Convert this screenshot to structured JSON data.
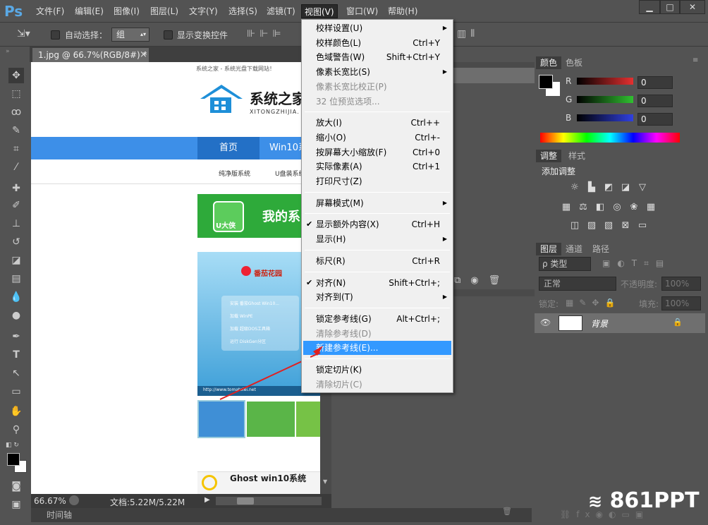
{
  "app": {
    "logo": "Ps"
  },
  "menubar": {
    "items": [
      "文件(F)",
      "编辑(E)",
      "图像(I)",
      "图层(L)",
      "文字(Y)",
      "选择(S)",
      "滤镜(T)",
      "视图(V)",
      "窗口(W)",
      "帮助(H)"
    ],
    "window_controls": [
      "▁",
      "□",
      "✕"
    ]
  },
  "options": {
    "auto_select_label": "自动选择：",
    "auto_select_value": "组",
    "show_transform_label": "显示变换控件"
  },
  "document": {
    "tab_title": "1.jpg @ 66.7%(RGB/8#) *",
    "tab_close": "×",
    "zoom": "66.67%",
    "doc_info": "文档:5.22M/5.22M",
    "timeline_label": "时间轴"
  },
  "webpage": {
    "top_text": "系统之家 - 系统光盘下载网站！",
    "logo_cn": "系统之家",
    "logo_pinyin": "XITONGZHIJIA.",
    "nav_home": "首页",
    "nav_win10": "Win10系",
    "subnav1": "纯净版系统",
    "subnav2": "U盘装系统",
    "banner_brand": "U大侠",
    "banner_text": "我的系",
    "promo_brand": "番茄花园",
    "promo_items": [
      "安装 番茄Ghost Win10...",
      "加载 WinPE",
      "加载 超级DOS工具箱",
      "运行 DiskGen分区"
    ],
    "promo_url": "http://www.tomatolei.net",
    "bottom_title": "Ghost win10系统"
  },
  "color_panel": {
    "tabs": [
      "颜色",
      "色板"
    ],
    "channels": [
      {
        "name": "R",
        "value": "0",
        "color": "#e53030"
      },
      {
        "name": "G",
        "value": "0",
        "color": "#30c030"
      },
      {
        "name": "B",
        "value": "0",
        "color": "#3040e0"
      }
    ]
  },
  "adjust_panel": {
    "tabs": [
      "调整",
      "样式"
    ],
    "title": "添加调整"
  },
  "layers_panel": {
    "tabs": [
      "图层",
      "通道",
      "路径"
    ],
    "filter_label": "ρ 类型",
    "blend_mode": "正常",
    "opacity_label": "不透明度:",
    "opacity_value": "100%",
    "lock_label": "锁定:",
    "fill_label": "填充:",
    "fill_value": "100%",
    "layer_name": "背景"
  },
  "view_menu": {
    "items": [
      {
        "label": "校样设置(U)",
        "shortcut": "",
        "arrow": true,
        "disabled": false,
        "checked": false
      },
      {
        "label": "校样颜色(L)",
        "shortcut": "Ctrl+Y",
        "arrow": false,
        "disabled": false,
        "checked": false
      },
      {
        "label": "色域警告(W)",
        "shortcut": "Shift+Ctrl+Y",
        "arrow": false,
        "disabled": false,
        "checked": false
      },
      {
        "label": "像素长宽比(S)",
        "shortcut": "",
        "arrow": true,
        "disabled": false,
        "checked": false
      },
      {
        "label": "像素长宽比校正(P)",
        "shortcut": "",
        "arrow": false,
        "disabled": true,
        "checked": false
      },
      {
        "label": "32 位预览选项...",
        "shortcut": "",
        "arrow": false,
        "disabled": true,
        "checked": false
      },
      {
        "label": "放大(I)",
        "shortcut": "Ctrl++",
        "arrow": false,
        "disabled": false,
        "checked": false
      },
      {
        "label": "缩小(O)",
        "shortcut": "Ctrl+-",
        "arrow": false,
        "disabled": false,
        "checked": false
      },
      {
        "label": "按屏幕大小缩放(F)",
        "shortcut": "Ctrl+0",
        "arrow": false,
        "disabled": false,
        "checked": false
      },
      {
        "label": "实际像素(A)",
        "shortcut": "Ctrl+1",
        "arrow": false,
        "disabled": false,
        "checked": false
      },
      {
        "label": "打印尺寸(Z)",
        "shortcut": "",
        "arrow": false,
        "disabled": false,
        "checked": false
      },
      {
        "label": "屏幕模式(M)",
        "shortcut": "",
        "arrow": true,
        "disabled": false,
        "checked": false
      },
      {
        "label": "显示额外内容(X)",
        "shortcut": "Ctrl+H",
        "arrow": false,
        "disabled": false,
        "checked": true
      },
      {
        "label": "显示(H)",
        "shortcut": "",
        "arrow": true,
        "disabled": false,
        "checked": false
      },
      {
        "label": "标尺(R)",
        "shortcut": "Ctrl+R",
        "arrow": false,
        "disabled": false,
        "checked": false
      },
      {
        "label": "对齐(N)",
        "shortcut": "Shift+Ctrl+;",
        "arrow": false,
        "disabled": false,
        "checked": true
      },
      {
        "label": "对齐到(T)",
        "shortcut": "",
        "arrow": true,
        "disabled": false,
        "checked": false
      },
      {
        "label": "锁定参考线(G)",
        "shortcut": "Alt+Ctrl+;",
        "arrow": false,
        "disabled": false,
        "checked": false
      },
      {
        "label": "清除参考线(D)",
        "shortcut": "",
        "arrow": false,
        "disabled": true,
        "checked": false
      },
      {
        "label": "新建参考线(E)...",
        "shortcut": "",
        "arrow": false,
        "disabled": false,
        "checked": false,
        "highlighted": true
      },
      {
        "label": "锁定切片(K)",
        "shortcut": "",
        "arrow": false,
        "disabled": false,
        "checked": false
      },
      {
        "label": "清除切片(C)",
        "shortcut": "",
        "arrow": false,
        "disabled": true,
        "checked": false
      }
    ]
  },
  "watermark": "861PPT",
  "colors": {
    "ui_bg": "#535353",
    "menu_highlight": "#3399ff",
    "nav_blue": "#3d8fe8"
  }
}
